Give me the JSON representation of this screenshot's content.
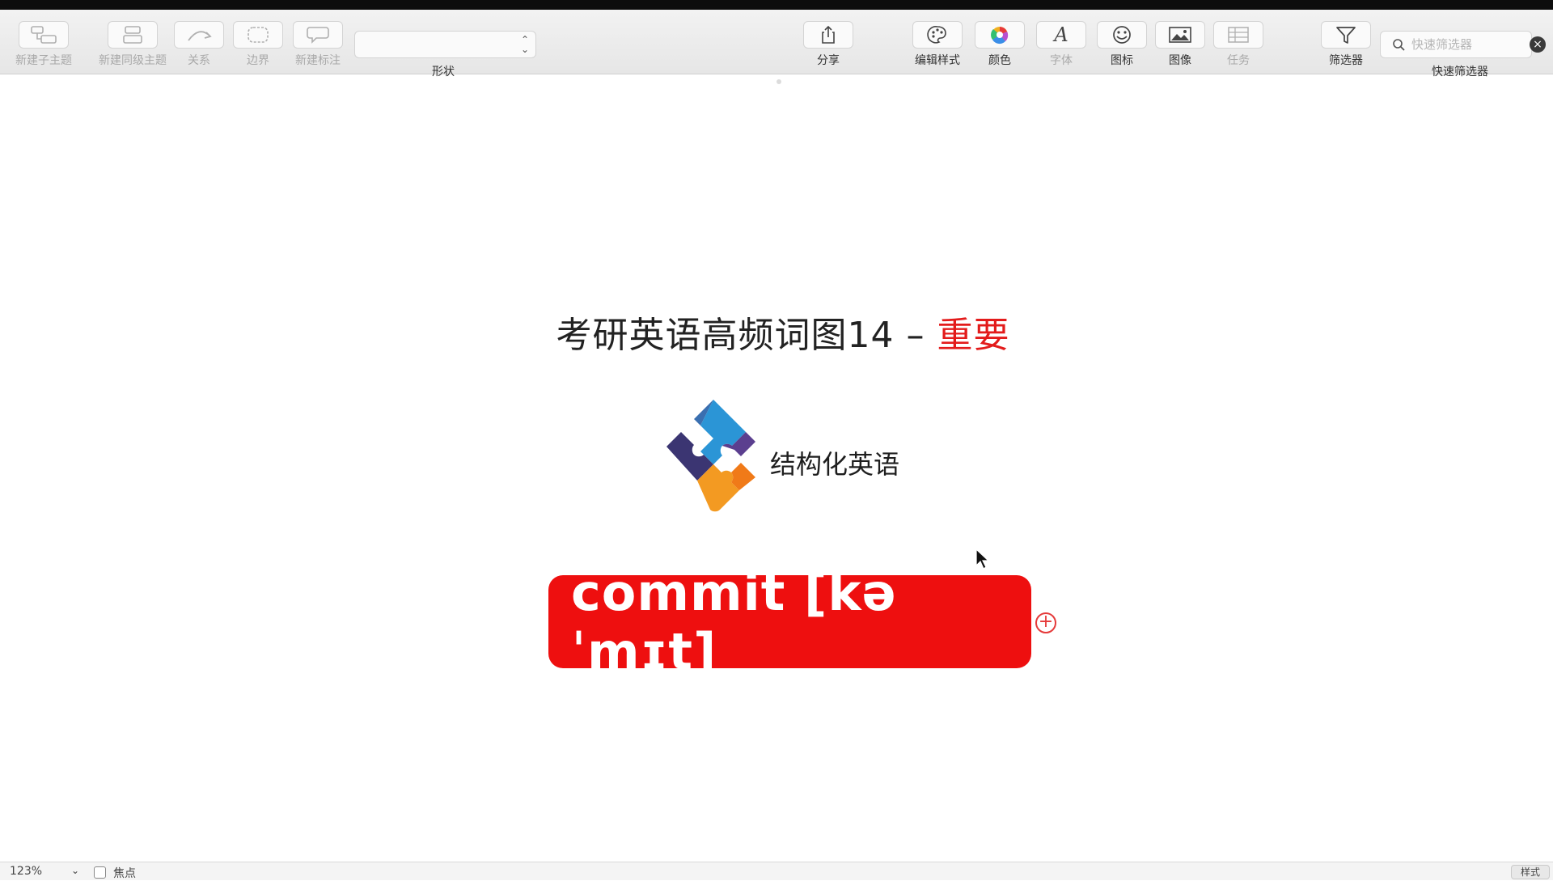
{
  "toolbar": {
    "new_subtopic": "新建子主题",
    "new_sibling": "新建同级主题",
    "relation": "关系",
    "boundary": "边界",
    "new_callout": "新建标注",
    "shape": "形状",
    "share": "分享",
    "edit_style": "编辑样式",
    "color": "颜色",
    "font": "字体",
    "icon": "图标",
    "image": "图像",
    "task": "任务",
    "filter": "筛选器",
    "quick_filter": "快速筛选器",
    "search_placeholder": "快速筛选器"
  },
  "canvas": {
    "title_main": "考研英语高频词图14 – ",
    "title_highlight": "重要",
    "logo_text": "结构化英语",
    "topic_text": "commit [kəˈmɪt]"
  },
  "status": {
    "zoom": "123%",
    "focus_label": "焦点",
    "style_label": "样式"
  },
  "colors": {
    "accent_red": "#ee0f0f",
    "title_red": "#e31b1b"
  }
}
